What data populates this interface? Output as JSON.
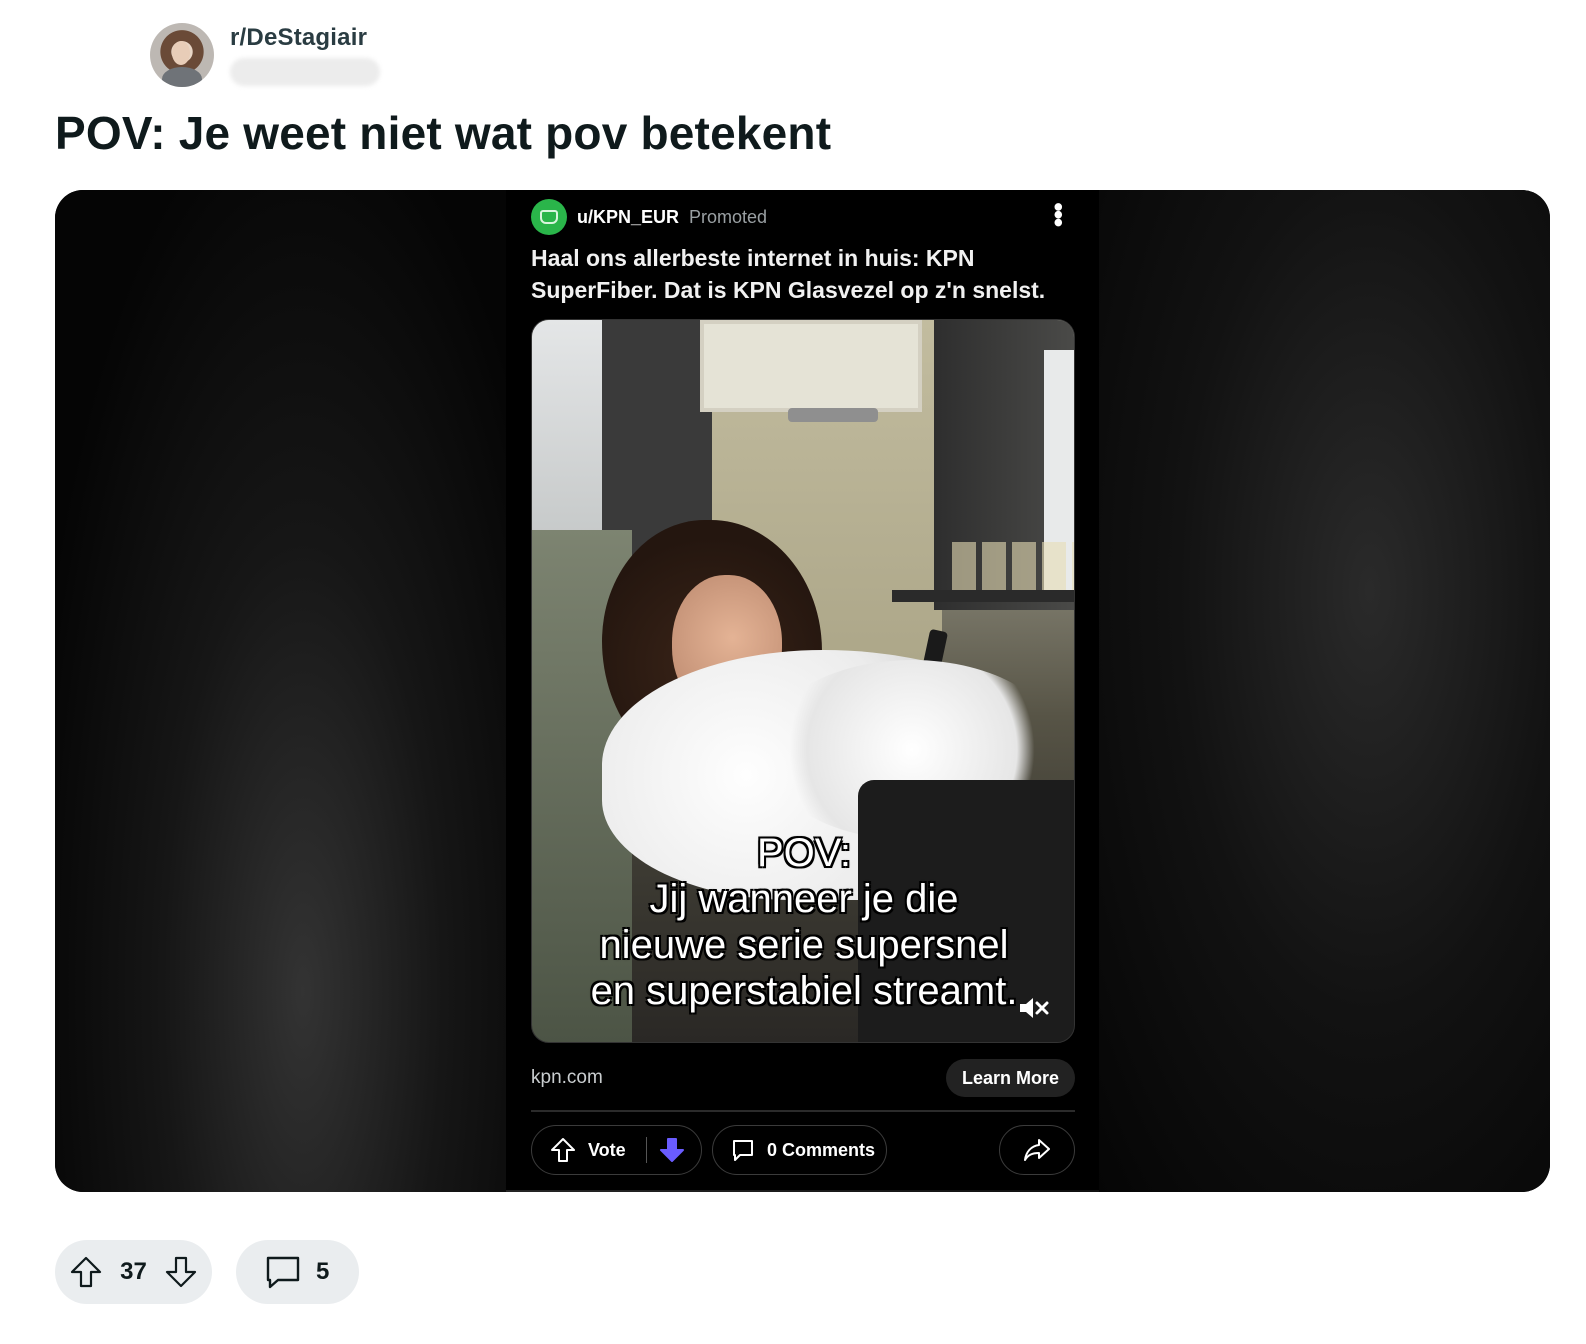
{
  "post": {
    "subreddit": "r/DeStagiair",
    "title": "POV: Je weet niet wat pov betekent",
    "score": "37",
    "comment_count": "5"
  },
  "ad": {
    "username": "u/KPN_EUR",
    "promoted_label": "Promoted",
    "headline": "Haal ons allerbeste internet in huis: KPN SuperFiber. Dat is KPN Glasvezel op z'n snelst.",
    "caption_line1": "POV:",
    "caption_line2": "Jij wanneer je die",
    "caption_line3": "nieuwe serie supersnel",
    "caption_line4": "en superstabiel streamt.",
    "domain": "kpn.com",
    "cta_label": "Learn More",
    "vote_label": "Vote",
    "comments_label": "0 Comments",
    "brand_color": "#2ab54a",
    "downvote_color": "#6a5cff"
  },
  "icons": {
    "upvote": "upvote-icon",
    "downvote": "downvote-icon",
    "comment": "comment-icon",
    "share": "share-icon",
    "more": "more-options-icon",
    "mute": "muted-speaker-icon"
  }
}
